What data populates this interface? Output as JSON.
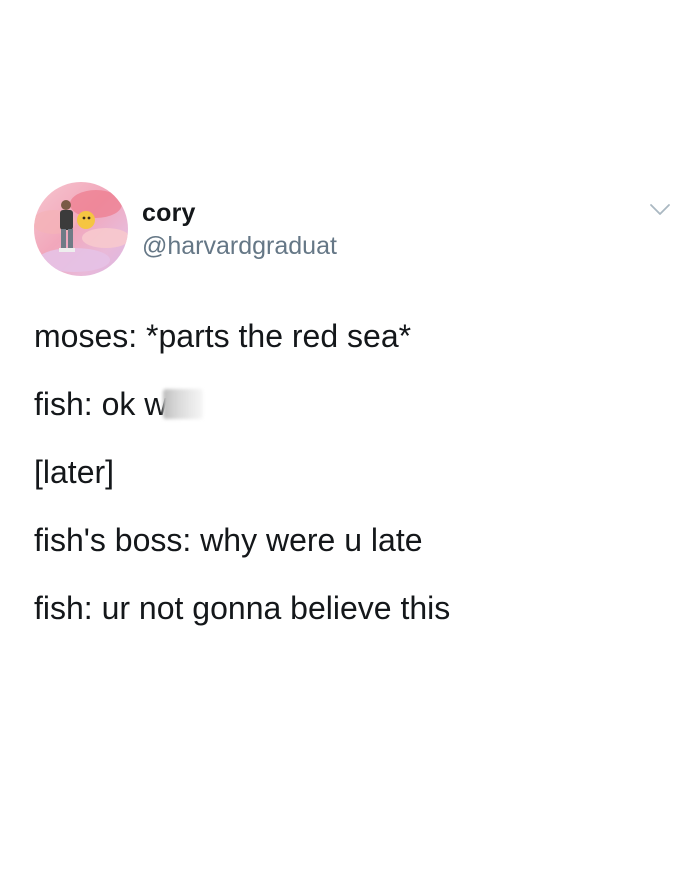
{
  "tweet": {
    "author": {
      "display_name": "cory",
      "handle": "@harvardgraduat",
      "avatar_icon": "profile-avatar-image"
    },
    "menu_icon": "chevron-down-icon",
    "lines": [
      "moses: *parts the red sea*",
      "fish: ok w",
      "[later]",
      "fish's boss: why were u late",
      "fish: ur not gonna believe this"
    ]
  },
  "colors": {
    "background": "#ffffff",
    "text_primary": "#14171a",
    "text_secondary": "#657786",
    "chevron": "#aab8c2"
  }
}
